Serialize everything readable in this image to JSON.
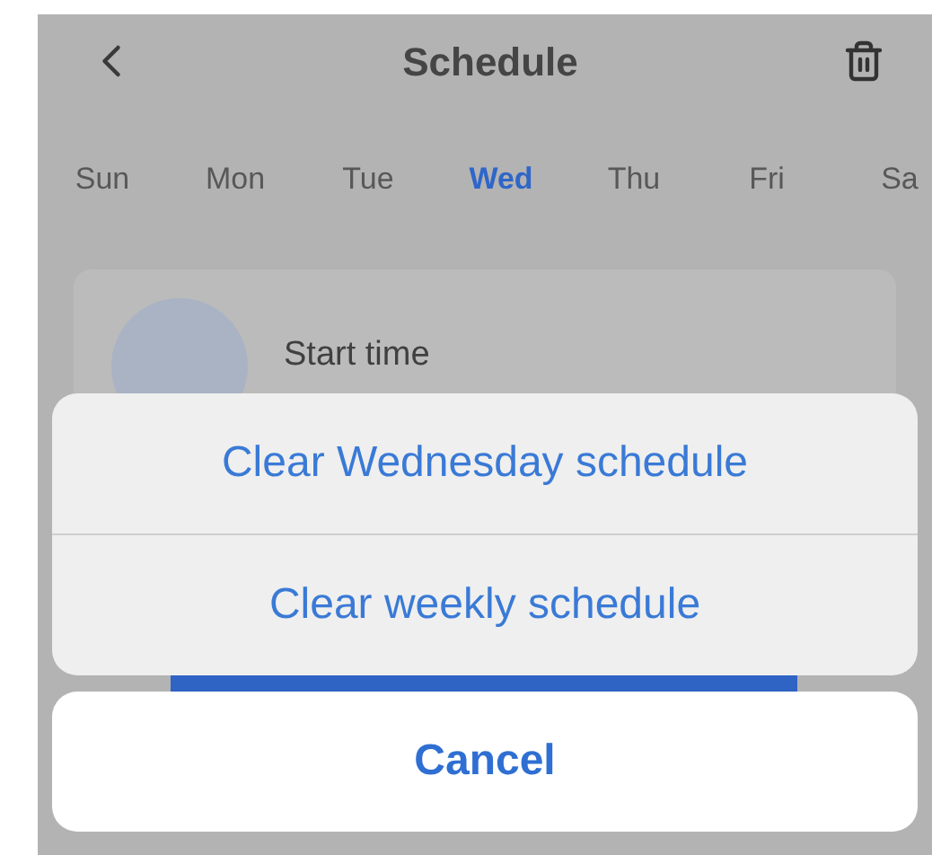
{
  "header": {
    "title": "Schedule"
  },
  "days": [
    {
      "label": "Sun",
      "selected": false
    },
    {
      "label": "Mon",
      "selected": false
    },
    {
      "label": "Tue",
      "selected": false
    },
    {
      "label": "Wed",
      "selected": true
    },
    {
      "label": "Thu",
      "selected": false
    },
    {
      "label": "Fri",
      "selected": false
    },
    {
      "label": "Sa",
      "selected": false
    }
  ],
  "card": {
    "label": "Start time"
  },
  "action_sheet": {
    "actions": [
      "Clear Wednesday schedule",
      "Clear weekly schedule"
    ],
    "cancel": "Cancel"
  }
}
